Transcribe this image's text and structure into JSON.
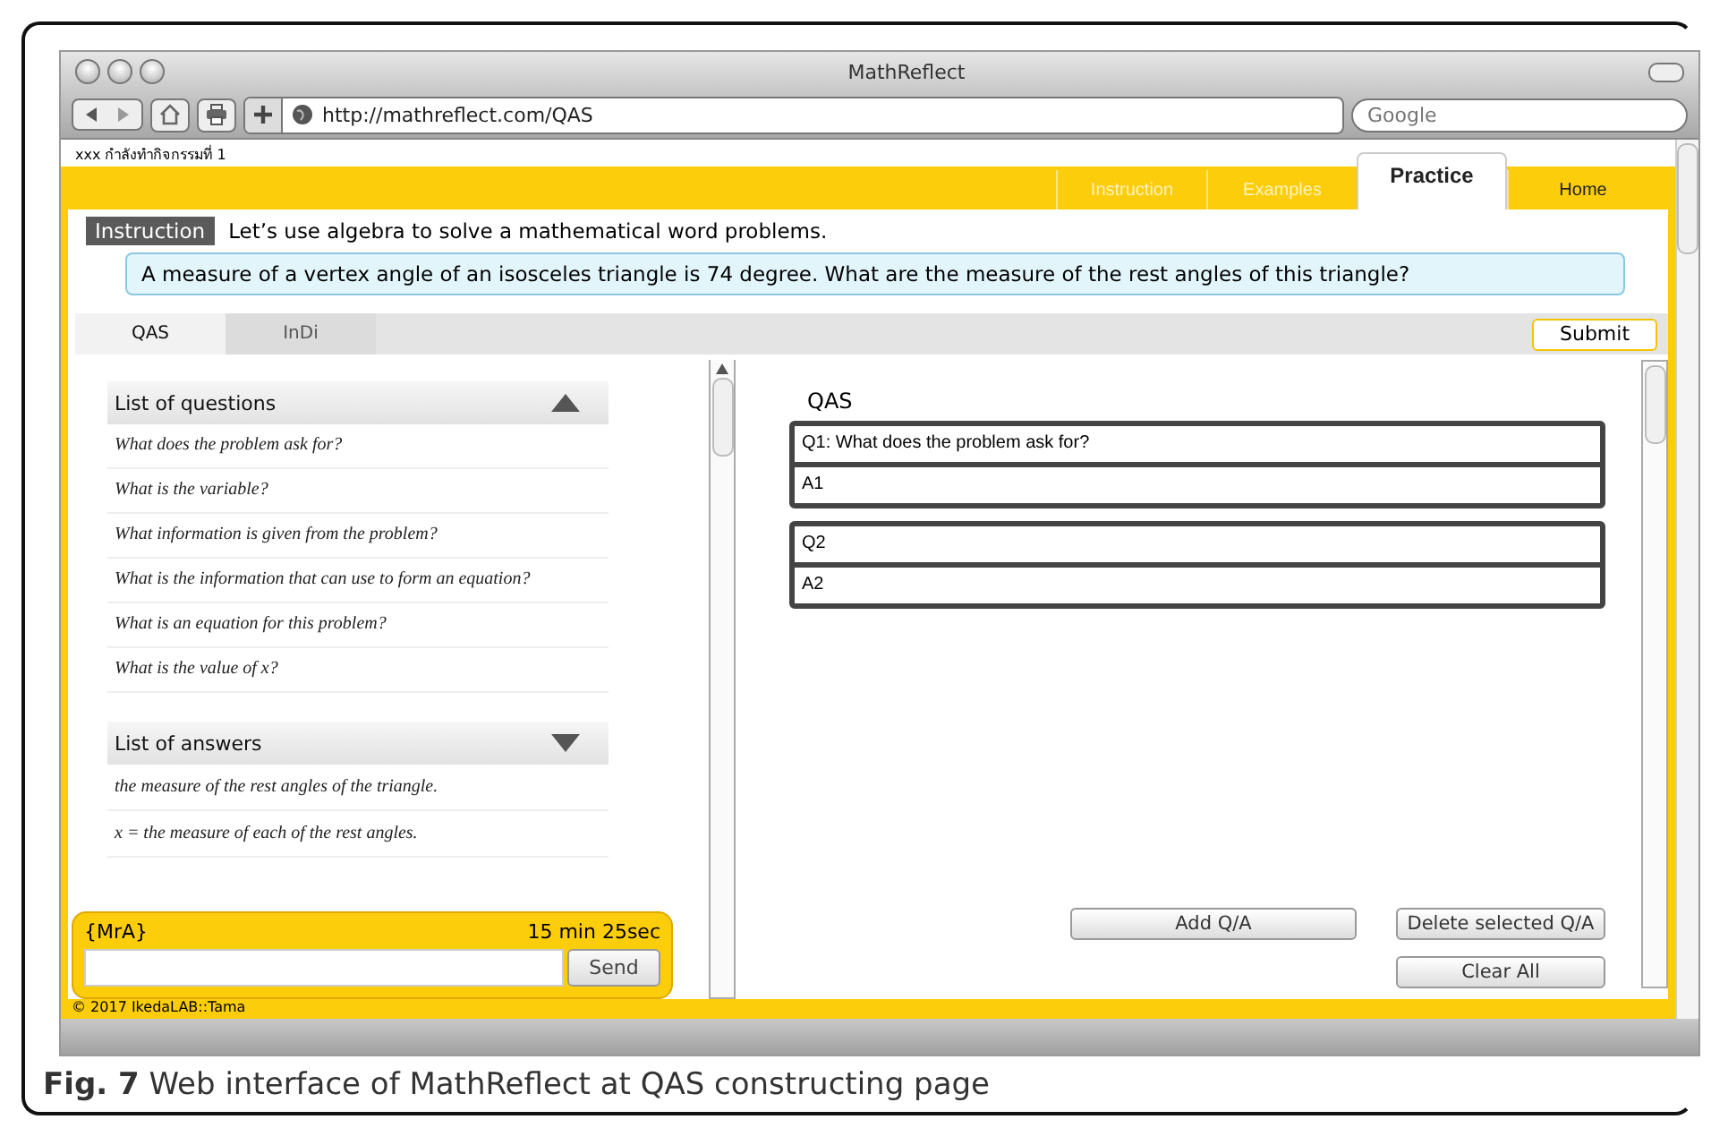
{
  "window": {
    "title": "MathReflect"
  },
  "toolbar": {
    "url": "http://mathreflect.com/QAS",
    "search_placeholder": "Google"
  },
  "status_text": "xxx กำลังทำกิจกรรมที่ 1",
  "nav_tabs": [
    {
      "label": "Instruction",
      "selected": false,
      "dimmed": true
    },
    {
      "label": "Examples",
      "selected": false,
      "dimmed": true
    },
    {
      "label": "Practice",
      "selected": true,
      "dimmed": false
    },
    {
      "label": "Home",
      "selected": false,
      "dimmed": false
    }
  ],
  "instruction": {
    "label": "Instruction",
    "text": "Let’s use algebra to solve a mathematical word problems."
  },
  "problem": "A measure of a vertex angle of an isosceles triangle is 74 degree. What are the measure of the rest angles of this triangle?",
  "tabs": [
    {
      "label": "QAS",
      "selected": true
    },
    {
      "label": "InDi",
      "selected": false
    }
  ],
  "submit": "Submit",
  "questions_panel": {
    "title": "List of questions",
    "expanded": true,
    "items": [
      "What does the problem ask for?",
      "What is the variable?",
      "What information is given from the problem?",
      "What is the information that can use to form an equation?",
      "What is an equation for this problem?",
      "What is the value of x?"
    ]
  },
  "answers_panel": {
    "title": "List of answers",
    "expanded": false,
    "items": [
      "the measure of the rest angles of the triangle.",
      "x = the measure of each of the rest angles."
    ]
  },
  "chat": {
    "user": "{MrA}",
    "timer": "15 min 25sec",
    "send": "Send"
  },
  "qas": {
    "heading": "QAS",
    "pairs": [
      {
        "question": "Q1: What does the problem ask for?",
        "answer": "A1"
      },
      {
        "question": "Q2",
        "answer": "A2"
      }
    ]
  },
  "buttons": {
    "add": "Add Q/A",
    "delete": "Delete selected Q/A",
    "clear": "Clear All"
  },
  "footer": "© 2017 IkedaLAB::Tama",
  "caption": "**Fig. 7** Web interface of MathReflect at QAS constructing page"
}
